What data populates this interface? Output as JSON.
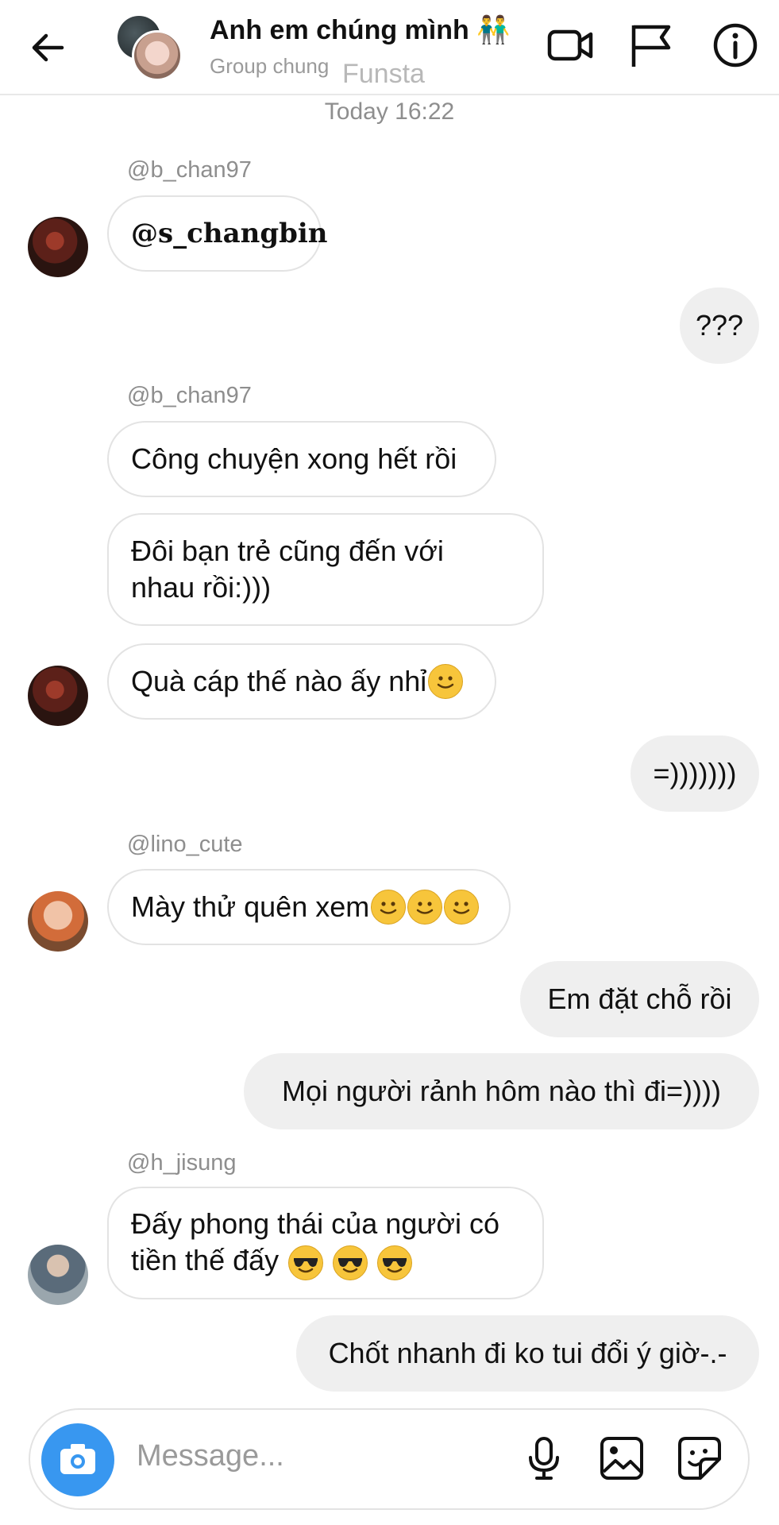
{
  "header": {
    "title": "Anh em chúng mình 👬",
    "subtitle": "Group chung",
    "watermark": "Funsta",
    "icons": [
      "back-arrow-icon",
      "video-call-icon",
      "flag-icon",
      "info-icon"
    ]
  },
  "thread": {
    "timestamp": "Today 16:22",
    "messages": [
      {
        "sender": "@b_chan97",
        "text": "@s_changbin"
      },
      {
        "text": "???"
      },
      {
        "sender": "@b_chan97",
        "text": "Công chuyện xong hết rồi"
      },
      {
        "line1": "Đôi bạn trẻ cũng đến với",
        "line2": "nhau rồi:)))"
      },
      {
        "text": "Quà cáp thế nào ấy nhỉ"
      },
      {
        "text": "=)))))))"
      },
      {
        "sender": "@lino_cute",
        "text": "Mày thử quên xem"
      },
      {
        "text": "Em đặt chỗ rồi"
      },
      {
        "text": "Mọi người rảnh hôm nào thì đi=))))"
      },
      {
        "sender": "@h_jisung",
        "line1": "Đấy phong thái của người có",
        "line2": "tiền thế đấy"
      },
      {
        "text": "Chốt nhanh đi ko tui đổi ý giờ-.-"
      }
    ]
  },
  "composer": {
    "placeholder": "Message...",
    "icons": [
      "camera-icon",
      "microphone-icon",
      "gallery-icon",
      "sticker-icon"
    ]
  },
  "colors": {
    "accent": "#3897f0",
    "outgoing_bubble": "#efefef",
    "incoming_border": "#e3e3e3"
  }
}
